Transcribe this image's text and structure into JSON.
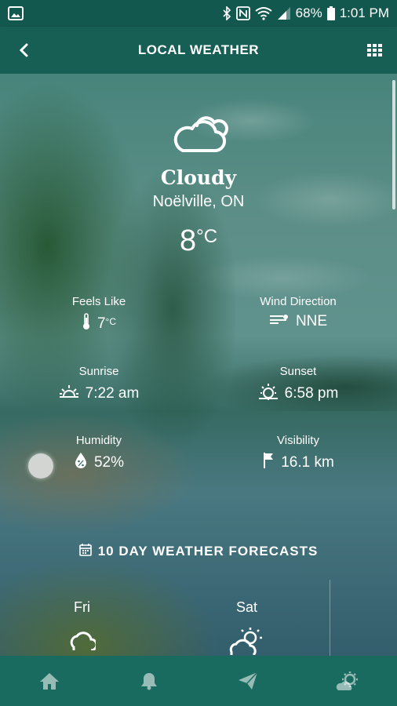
{
  "status_bar": {
    "battery": "68%",
    "time": "1:01 PM"
  },
  "app_bar": {
    "title": "LOCAL WEATHER",
    "back_icon": "back-chevron-icon",
    "menu_icon": "grid-menu-icon"
  },
  "current": {
    "condition": "Cloudy",
    "location": "Noëlville, ON",
    "temp_value": "8",
    "temp_unit": "°C",
    "icon": "cloud-icon"
  },
  "metrics": {
    "feels_like": {
      "label": "Feels Like",
      "value": "7",
      "unit": "°C",
      "icon": "thermometer-icon"
    },
    "wind_direction": {
      "label": "Wind Direction",
      "value": "NNE",
      "icon": "wind-icon"
    },
    "sunrise": {
      "label": "Sunrise",
      "value": "7:22 am",
      "icon": "sunrise-icon"
    },
    "sunset": {
      "label": "Sunset",
      "value": "6:58 pm",
      "icon": "sunset-icon"
    },
    "humidity": {
      "label": "Humidity",
      "value": "52%",
      "icon": "humidity-icon"
    },
    "visibility": {
      "label": "Visibility",
      "value": "16.1 km",
      "icon": "flag-icon"
    }
  },
  "forecast": {
    "header": "10 DAY WEATHER FORECASTS",
    "days": [
      {
        "day": "Fri",
        "icon": "cloud-icon"
      },
      {
        "day": "Sat",
        "icon": "partly-sunny-icon"
      }
    ]
  },
  "bottom_nav": [
    "home-icon",
    "bell-icon",
    "send-icon",
    "weather-settings-icon"
  ],
  "colors": {
    "primary": "#175e55",
    "nav": "#1a6b5f"
  }
}
